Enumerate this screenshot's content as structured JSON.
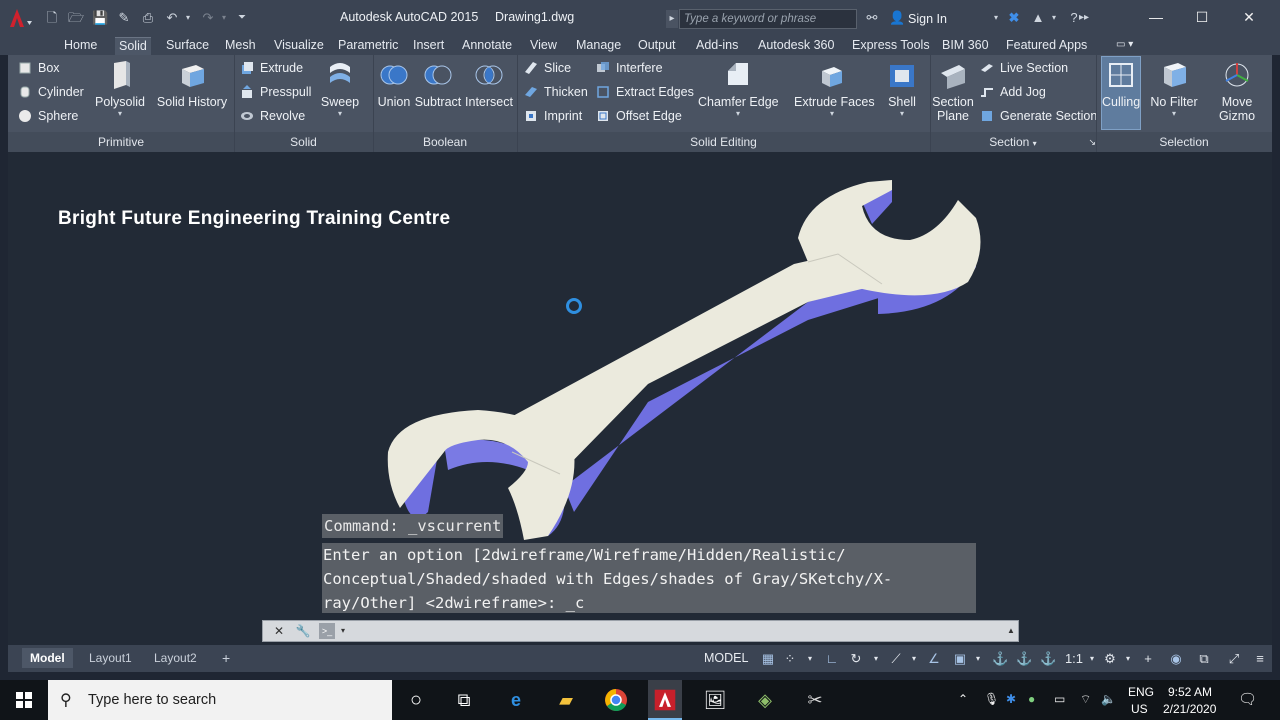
{
  "window": {
    "app_title": "Autodesk AutoCAD 2015",
    "file_name": "Drawing1.dwg",
    "search_placeholder": "Type a keyword or phrase",
    "sign_in": "Sign In"
  },
  "ribbon": {
    "tabs": [
      "Home",
      "Solid",
      "Surface",
      "Mesh",
      "Visualize",
      "Parametric",
      "Insert",
      "Annotate",
      "View",
      "Manage",
      "Output",
      "Add-ins",
      "Autodesk 360",
      "Express Tools",
      "BIM 360",
      "Featured Apps"
    ],
    "active_tab": "Solid",
    "panels": {
      "primitive": {
        "title": "Primitive",
        "box": "Box",
        "cylinder": "Cylinder",
        "sphere": "Sphere",
        "polysolid": "Polysolid",
        "solid_history": "Solid History"
      },
      "solid": {
        "title": "Solid",
        "extrude": "Extrude",
        "presspull": "Presspull",
        "revolve": "Revolve",
        "sweep": "Sweep"
      },
      "boolean": {
        "title": "Boolean",
        "union": "Union",
        "subtract": "Subtract",
        "intersect": "Intersect"
      },
      "solid_editing": {
        "title": "Solid Editing",
        "slice": "Slice",
        "thicken": "Thicken",
        "imprint": "Imprint",
        "interfere": "Interfere",
        "extract_edges": "Extract Edges",
        "offset_edge": "Offset Edge",
        "chamfer_edge": "Chamfer Edge",
        "extrude_faces": "Extrude Faces",
        "shell": "Shell"
      },
      "section": {
        "title": "Section",
        "section_plane_1": "Section",
        "section_plane_2": "Plane",
        "live_section": "Live Section",
        "add_jog": "Add Jog",
        "generate_section": "Generate Section"
      },
      "selection": {
        "title": "Selection",
        "culling": "Culling",
        "no_filter": "No Filter",
        "move_gizmo_1": "Move",
        "move_gizmo_2": "Gizmo"
      }
    }
  },
  "viewport": {
    "overlay_title": "Bright Future Engineering Training Centre"
  },
  "command": {
    "history_line": "Command:  _vscurrent",
    "prompt_lines": [
      "Enter an option [2dwireframe/Wireframe/Hidden/Realistic/",
      "Conceptual/Shaded/shaded with Edges/shades of Gray/SKetchy/X-",
      "ray/Other] <2dwireframe>: _c"
    ]
  },
  "layout_tabs": [
    "Model",
    "Layout1",
    "Layout2"
  ],
  "status": {
    "model": "MODEL",
    "scale": "1:1"
  },
  "taskbar": {
    "search_placeholder": "Type here to search",
    "lang_top": "ENG",
    "lang_bottom": "US",
    "time": "9:52 AM",
    "date": "2/21/2020"
  },
  "colors": {
    "accent_blue": "#2f8fe0",
    "wrench_face": "#e9e8dc",
    "wrench_side": "#6f6fe0",
    "viewport_bg": "#222a36",
    "autocad_red": "#d0212d"
  }
}
